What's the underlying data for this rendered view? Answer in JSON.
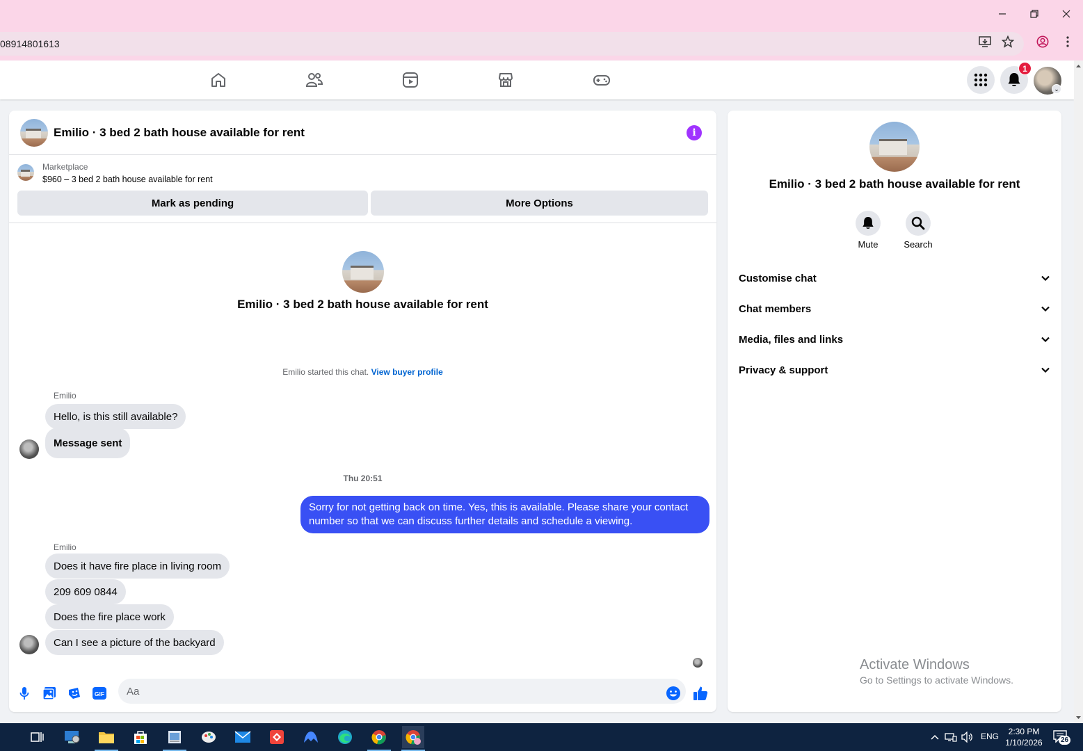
{
  "browser": {
    "url_fragment": "08914801613"
  },
  "nav": {
    "notification_count": "1"
  },
  "chat": {
    "title": "Emilio · 3 bed 2 bath house available for rent",
    "marketplace_label": "Marketplace",
    "listing_desc": "$960 – 3 bed 2 bath house available for rent",
    "mark_pending_label": "Mark as pending",
    "more_options_label": "More Options",
    "hero_name": "Emilio · 3 bed 2 bath house available for rent",
    "started_text": "Emilio started this chat.",
    "view_profile_link": "View buyer profile",
    "timestamp": "Thu 20:51",
    "sender_name": "Emilio",
    "messages_group1": [
      "Hello, is this still available?",
      "Message sent"
    ],
    "outgoing_message": "Sorry for not getting back on time. Yes, this is available. Please share your contact number so that we can discuss further details and schedule a viewing.",
    "messages_group2": [
      "Does it have fire place in living room",
      "209 609 0844",
      "Does the fire place work",
      "Can I see a picture of the backyard"
    ],
    "input_placeholder": "Aa"
  },
  "info_panel": {
    "name": "Emilio · 3 bed 2 bath house available for rent",
    "mute_label": "Mute",
    "search_label": "Search",
    "sections": [
      "Customise chat",
      "Chat members",
      "Media, files and links",
      "Privacy & support"
    ]
  },
  "watermark": {
    "title": "Activate Windows",
    "subtitle": "Go to Settings to activate Windows."
  },
  "taskbar": {
    "language": "ENG",
    "time": "2:30 PM",
    "date": "1/10/2026",
    "notification_count": "26"
  },
  "colors": {
    "accent": "#3950f4",
    "link": "#0064d1",
    "info_icon": "#a033ff",
    "badge": "#e41e3f",
    "chrome_bg": "#fbd6e8"
  }
}
